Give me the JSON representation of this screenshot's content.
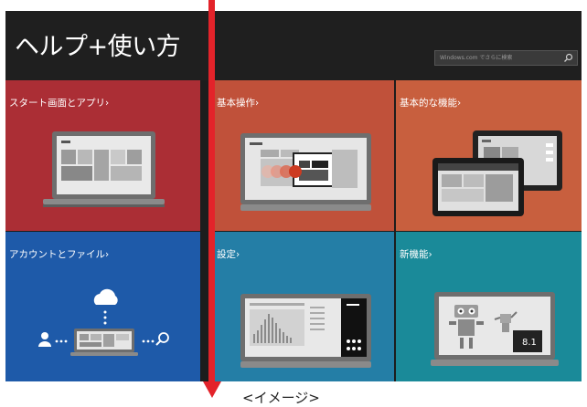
{
  "header": {
    "title": "ヘルプ+使い方",
    "search_placeholder": "Windows.com でさらに検索"
  },
  "tiles": [
    {
      "label": "スタート画面とアプリ›",
      "color": "#ab2e35",
      "icon": "laptop-start-screen-icon"
    },
    {
      "label": "基本操作›",
      "color": "#c0513a",
      "icon": "laptop-touch-swipe-icon"
    },
    {
      "label": "基本的な機能›",
      "color": "#c85f3e",
      "icon": "tablet-windows-icon"
    },
    {
      "label": "アカウントとファイル›",
      "color": "#1e5aa9",
      "icon": "cloud-account-file-icon"
    },
    {
      "label": "設定›",
      "color": "#247ea6",
      "icon": "laptop-settings-icon"
    },
    {
      "label": "新機能›",
      "color": "#1a8a99",
      "icon": "robot-new-features-icon"
    }
  ],
  "badge": "8.1",
  "caption": "<イメージ>"
}
